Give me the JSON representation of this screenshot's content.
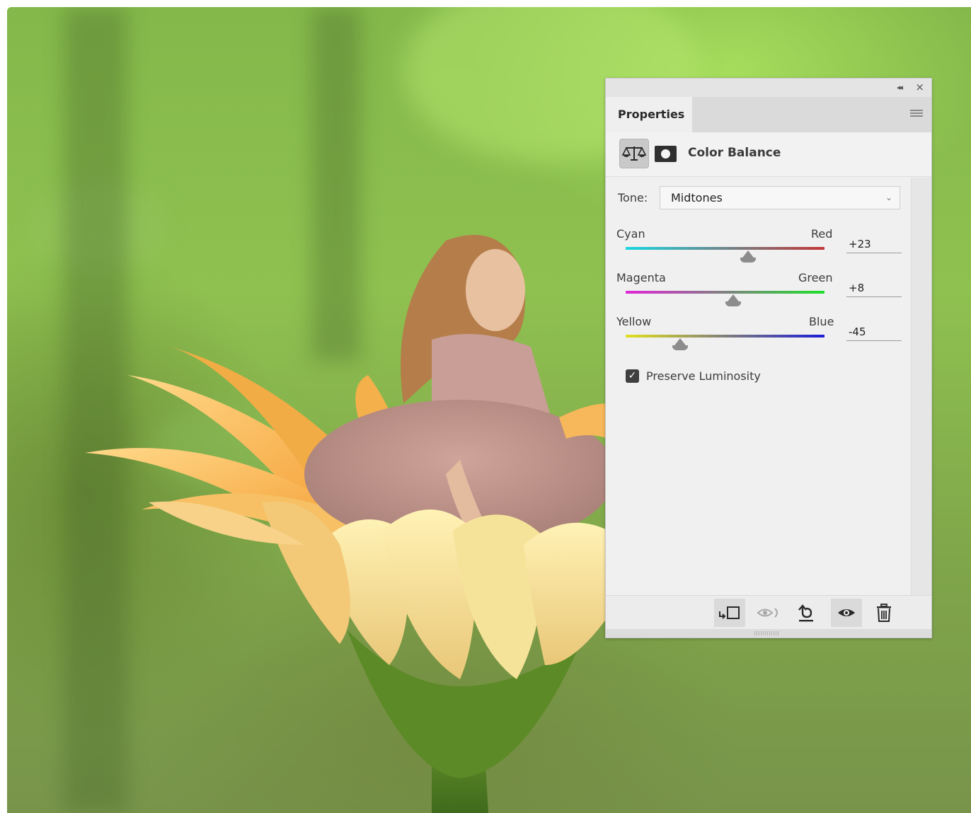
{
  "panel": {
    "tab_label": "Properties",
    "adjustment_title": "Color Balance",
    "tone": {
      "label": "Tone:",
      "value": "Midtones"
    },
    "sliders": [
      {
        "left_label": "Cyan",
        "right_label": "Red",
        "value_text": "+23",
        "value": 23,
        "min": -100,
        "max": 100
      },
      {
        "left_label": "Magenta",
        "right_label": "Green",
        "value_text": "+8",
        "value": 8,
        "min": -100,
        "max": 100
      },
      {
        "left_label": "Yellow",
        "right_label": "Blue",
        "value_text": "-45",
        "value": -45,
        "min": -100,
        "max": 100
      }
    ],
    "preserve_luminosity": {
      "label": "Preserve Luminosity",
      "checked": true
    },
    "icons": {
      "collapse": "double-chevron-left-icon",
      "close": "close-icon",
      "menu": "panel-menu-icon",
      "adjustment": "balance-scale-icon",
      "mask": "layer-mask-icon",
      "clip": "clip-to-layer-icon",
      "view_previous": "view-previous-state-icon",
      "reset": "reset-icon",
      "visibility": "eye-icon",
      "delete": "trash-icon"
    }
  }
}
